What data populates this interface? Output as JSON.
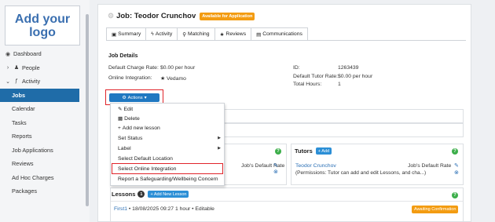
{
  "sidebar": {
    "logo_text": "Add your logo",
    "items": [
      {
        "label": "Dashboard",
        "icon": "dashboard-icon",
        "glyph": "◉"
      },
      {
        "label": "People",
        "icon": "people-icon",
        "glyph": "›"
      },
      {
        "label": "Activity",
        "icon": "activity-icon",
        "glyph": "⌄"
      },
      {
        "label": "Jobs"
      },
      {
        "label": "Calendar"
      },
      {
        "label": "Tasks"
      },
      {
        "label": "Reports"
      },
      {
        "label": "Job Applications"
      },
      {
        "label": "Reviews"
      },
      {
        "label": "Ad Hoc Charges"
      },
      {
        "label": "Packages"
      }
    ]
  },
  "job": {
    "title": "Job: Teodor Crunchov",
    "status_badge": "Available for Application"
  },
  "tabs": [
    {
      "label": "Summary",
      "icon": "summary-icon",
      "glyph": "▣"
    },
    {
      "label": "Activity",
      "icon": "activity-icon",
      "glyph": "ϟ"
    },
    {
      "label": "Matching",
      "icon": "matching-icon",
      "glyph": "⚲"
    },
    {
      "label": "Reviews",
      "icon": "star-icon",
      "glyph": "★"
    },
    {
      "label": "Communications",
      "icon": "communications-icon",
      "glyph": "▤"
    }
  ],
  "details": {
    "title": "Job Details",
    "charge_rate_label": "Default Charge Rate:",
    "charge_rate_value": "$0.00 per hour",
    "integration_label": "Online Integration:",
    "integration_value": "Vedamo",
    "id_label": "ID:",
    "id_value": "1263439",
    "tutor_rate_label": "Default Tutor Rate:",
    "tutor_rate_value": "$0.00 per hour",
    "hours_label": "Total Hours:",
    "hours_value": "1"
  },
  "actions": {
    "button_label": "Actions",
    "menu": [
      {
        "label": "Edit",
        "icon": "edit-icon",
        "glyph": "✎",
        "submenu": false
      },
      {
        "label": "Delete",
        "icon": "trash-icon",
        "glyph": "🗑",
        "submenu": false
      },
      {
        "label": "Add new lesson",
        "icon": "plus-icon",
        "glyph": "+",
        "submenu": false
      },
      {
        "label": "Set Status",
        "submenu": true
      },
      {
        "label": "Label",
        "submenu": true
      },
      {
        "label": "Select Default Location",
        "submenu": false
      },
      {
        "label": "Select Online Integration",
        "submenu": false
      },
      {
        "label": "Report a Safeguarding/Wellbeing Concern",
        "submenu": false
      }
    ]
  },
  "students": {
    "rate_label": "Job's Default Rate"
  },
  "tutors": {
    "title": "Tutors",
    "add_label": "Add",
    "tutor_name": "Teodor Crunchov",
    "rate_label": "Job's Default Rate",
    "permissions": "(Permissions: Tutor can add and edit Lessons, and cha...)"
  },
  "lessons": {
    "title": "Lessons",
    "count": "1",
    "add_label": "Add New Lesson",
    "row_link": "First1",
    "row_text": "• 18/08/2025 09:27 1 hour • Editable",
    "status": "Awaiting Confirmation",
    "help_glyph": "?"
  },
  "colors": {
    "primary": "#1f6ca8",
    "button_blue": "#1f78c1",
    "badge_orange": "#f39c12",
    "highlight_red": "#e0242a",
    "help_green": "#3cae4a"
  }
}
